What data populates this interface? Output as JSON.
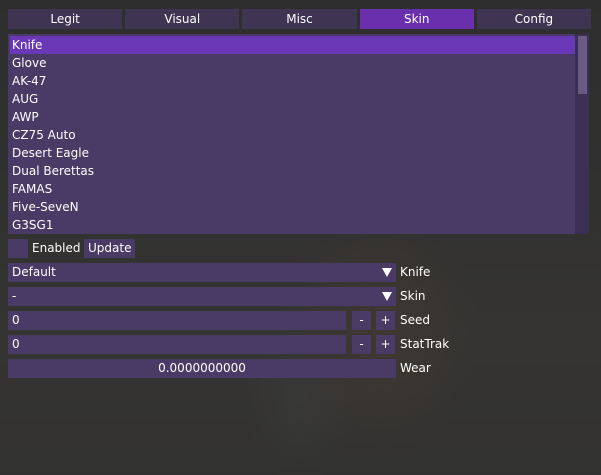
{
  "tabs": [
    {
      "label": "Legit",
      "active": false
    },
    {
      "label": "Visual",
      "active": false
    },
    {
      "label": "Misc",
      "active": false
    },
    {
      "label": "Skin",
      "active": true
    },
    {
      "label": "Config",
      "active": false
    }
  ],
  "weapon_list": {
    "items": [
      "Knife",
      "Glove",
      "AK-47",
      "AUG",
      "AWP",
      "CZ75 Auto",
      "Desert Eagle",
      "Dual Berettas",
      "FAMAS",
      "Five-SeveN",
      "G3SG1"
    ],
    "selected_index": 0
  },
  "enabled": {
    "label": "Enabled",
    "checked": false
  },
  "update_button": {
    "label": "Update"
  },
  "knife_select": {
    "value": "Default",
    "label": "Knife"
  },
  "skin_select": {
    "value": "-",
    "label": "Skin"
  },
  "seed": {
    "value": "0",
    "label": "Seed",
    "minus": "-",
    "plus": "+"
  },
  "stattrak": {
    "value": "0",
    "label": "StatTrak",
    "minus": "-",
    "plus": "+"
  },
  "wear": {
    "value": "0.0000000000",
    "fraction": 0.0,
    "label": "Wear"
  },
  "colors": {
    "accent": "#6a2fad",
    "widget_bg": "#4a3a66",
    "tab_bg": "#3f3553"
  },
  "icons": {
    "dropdown_arrow": "triangle-down"
  }
}
